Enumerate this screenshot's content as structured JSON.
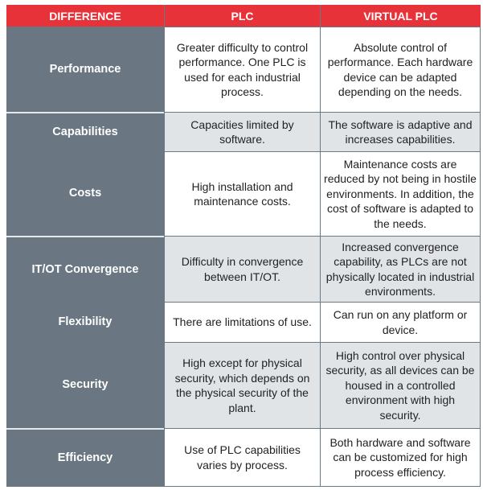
{
  "header": {
    "difference": "DIFFERENCE",
    "plc": "PLC",
    "virtual_plc": "VIRTUAL PLC"
  },
  "colors": {
    "header_bg": "#e8323a",
    "label_bg": "#6a7782",
    "alt_row_bg": "#e1e4e7"
  },
  "rows": [
    {
      "difference": "Performance",
      "plc": "Greater difficulty to control performance. One PLC is used for each industrial process.",
      "virtual_plc": "Absolute control of performance. Each hardware device can be adapted depending on the needs."
    },
    {
      "difference": "Capabilities",
      "plc": "Capacities limited by software.",
      "virtual_plc": "The software is adaptive and increases capabilities."
    },
    {
      "difference": "Costs",
      "plc": "High installation and maintenance costs.",
      "virtual_plc": "Maintenance costs are reduced by not being in hostile environments. In addition, the cost of software is adapted to the needs."
    },
    {
      "difference": "IT/OT Convergence",
      "plc": "Difficulty in convergence between IT/OT.",
      "virtual_plc": "Increased convergence capability, as PLCs are not physically located in industrial environments."
    },
    {
      "difference": "Flexibility",
      "plc": "There are limitations of use.",
      "virtual_plc": "Can run on any platform or device."
    },
    {
      "difference": "Security",
      "plc": "High except for physical security, which depends on the physical security of the plant.",
      "virtual_plc": "High control over physical security, as all devices can be housed in a controlled environment with high security."
    },
    {
      "difference": "Efficiency",
      "plc": "Use of PLC capabilities varies by process.",
      "virtual_plc": "Both hardware and software can be customized for high process efficiency."
    }
  ]
}
